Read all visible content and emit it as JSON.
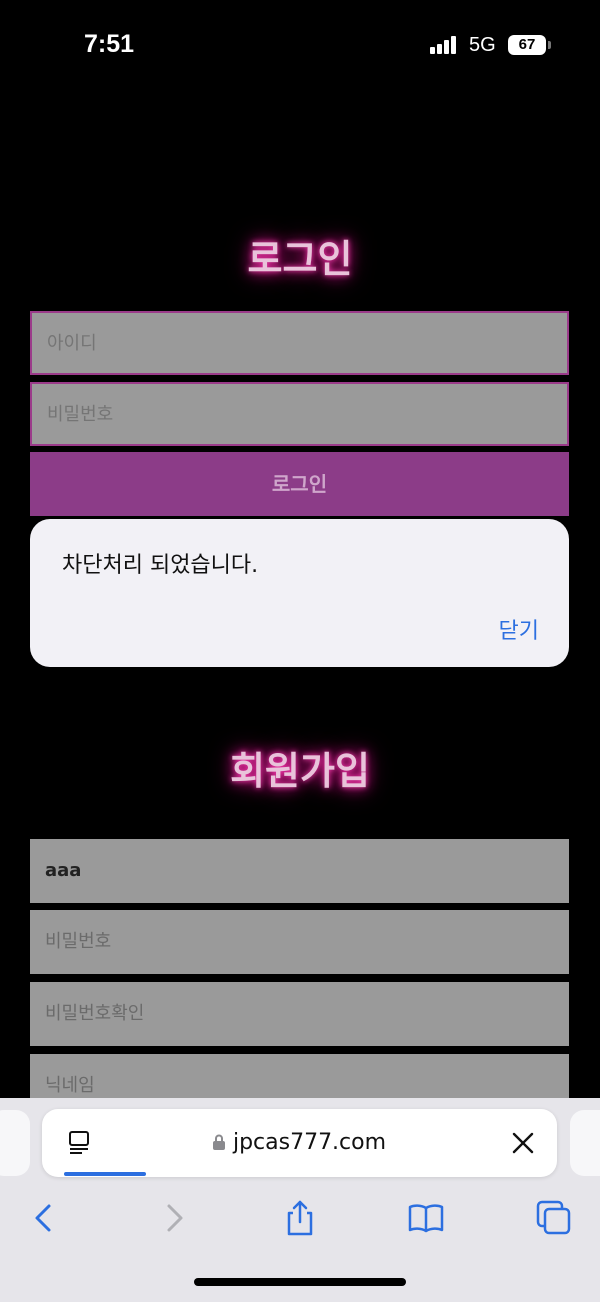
{
  "status_bar": {
    "time": "7:51",
    "network": "5G",
    "battery": "67"
  },
  "login": {
    "heading": "로그인",
    "id_placeholder": "아이디",
    "password_placeholder": "비밀번호",
    "button_label": "로그인"
  },
  "alert": {
    "message": "차단처리 되었습니다.",
    "close_label": "닫기"
  },
  "signup": {
    "heading": "회원가입",
    "id_value": "aaa",
    "password_placeholder": "비밀번호",
    "password_confirm_placeholder": "비밀번호확인",
    "nickname_placeholder": "닉네임"
  },
  "browser": {
    "url": "jpcas777.com",
    "accent_color": "#2c6fe0",
    "icons": [
      "reader-icon",
      "lock-icon",
      "close-icon",
      "back-icon",
      "forward-icon",
      "share-icon",
      "bookmarks-icon",
      "tabs-icon"
    ]
  }
}
